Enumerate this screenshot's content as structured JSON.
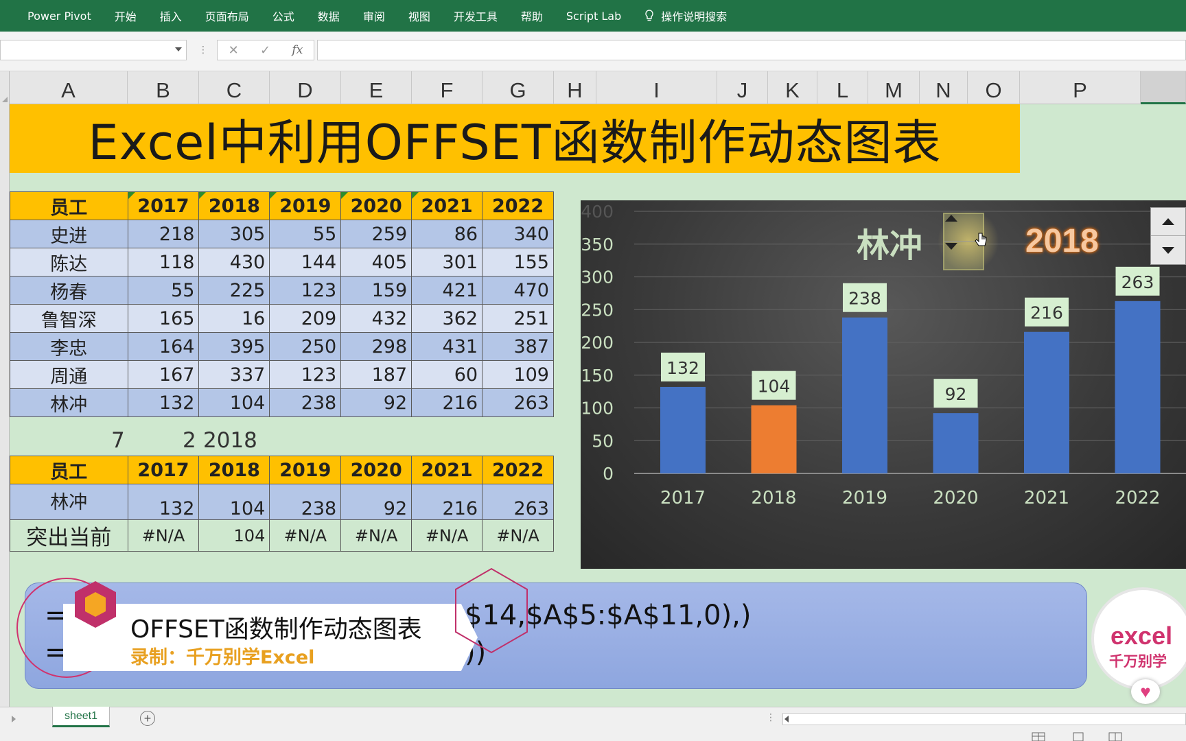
{
  "ribbon": {
    "tabs": [
      "Power Pivot",
      "开始",
      "插入",
      "页面布局",
      "公式",
      "数据",
      "审阅",
      "视图",
      "开发工具",
      "帮助",
      "Script Lab"
    ],
    "search_label": "操作说明搜索"
  },
  "formula_bar": {
    "cancel_glyph": "✕",
    "enter_glyph": "✓",
    "fx_label": "fx",
    "value": ""
  },
  "columns": [
    "A",
    "B",
    "C",
    "D",
    "E",
    "F",
    "G",
    "H",
    "I",
    "J",
    "K",
    "L",
    "M",
    "N",
    "O",
    "P"
  ],
  "title": "Excel中利用OFFSET函数制作动态图表",
  "table1": {
    "headers": [
      "员工",
      "2017",
      "2018",
      "2019",
      "2020",
      "2021",
      "2022"
    ],
    "rows": [
      [
        "史进",
        "218",
        "305",
        "55",
        "259",
        "86",
        "340"
      ],
      [
        "陈达",
        "118",
        "430",
        "144",
        "405",
        "301",
        "155"
      ],
      [
        "杨春",
        "55",
        "225",
        "123",
        "159",
        "421",
        "470"
      ],
      [
        "鲁智深",
        "165",
        "16",
        "209",
        "432",
        "362",
        "251"
      ],
      [
        "李忠",
        "164",
        "395",
        "250",
        "298",
        "431",
        "387"
      ],
      [
        "周通",
        "167",
        "337",
        "123",
        "187",
        "60",
        "109"
      ],
      [
        "林冲",
        "132",
        "104",
        "238",
        "92",
        "216",
        "263"
      ]
    ]
  },
  "helper_row": {
    "a": "7",
    "b": "2",
    "c": "2018"
  },
  "table2": {
    "headers": [
      "员工",
      "2017",
      "2018",
      "2019",
      "2020",
      "2021",
      "2022"
    ],
    "row": [
      "林冲",
      "132",
      "104",
      "238",
      "92",
      "216",
      "263"
    ],
    "highlight_row": [
      "突出当前",
      "#N/A",
      "104",
      "#N/A",
      "#N/A",
      "#N/A",
      "#N/A"
    ]
  },
  "chart_data": {
    "type": "bar",
    "title": "林冲",
    "highlight_label": "2018",
    "categories": [
      "2017",
      "2018",
      "2019",
      "2020",
      "2021",
      "2022"
    ],
    "values": [
      132,
      104,
      238,
      92,
      216,
      263
    ],
    "highlight_index": 1,
    "ylim": [
      0,
      400
    ],
    "yticks": [
      0,
      50,
      100,
      150,
      200,
      250,
      300,
      350,
      400
    ],
    "colors": {
      "bar": "#4472c4",
      "highlight": "#ed7d31",
      "label_bg": "#d6efd0",
      "axis_text": "#c9dfc0"
    },
    "grid": true
  },
  "formula_panel": {
    "line1_head": "=O",
    "line1_tail": "$14,$A$5:$A$11,0),)",
    "line2_head": "=I",
    "line2_tail": "))"
  },
  "overlay": {
    "title": "OFFSET函数制作动态图表",
    "subtitle": "录制：千万别学Excel"
  },
  "logo": {
    "line1": "excel",
    "line2": "千万别学"
  },
  "sheet_tab": "sheet1"
}
